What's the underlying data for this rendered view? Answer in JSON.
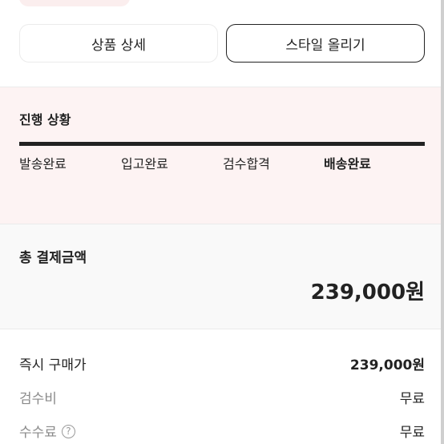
{
  "buttons": {
    "product_detail": "상품 상세",
    "upload_style": "스타일 올리기"
  },
  "progress": {
    "title": "진행 상황",
    "steps": [
      "발송완료",
      "입고완료",
      "검수합격",
      "배송완료"
    ],
    "current_step_index": 3,
    "completion": 1.0
  },
  "payment": {
    "total_label": "총 결제금액",
    "total_amount": "239,000원",
    "rows": [
      {
        "label": "즉시 구매가",
        "value": "239,000원"
      },
      {
        "label": "검수비",
        "value": "무료"
      },
      {
        "label": "수수료",
        "value": "무료",
        "help_icon": "?"
      }
    ]
  },
  "colors": {
    "progress_bg": "#fdf3f3",
    "total_bg": "#f9f9f9",
    "primary_text": "#222222",
    "muted_text": "#8a8a8a"
  },
  "icons": {
    "fee_help": "question-circle-icon"
  }
}
